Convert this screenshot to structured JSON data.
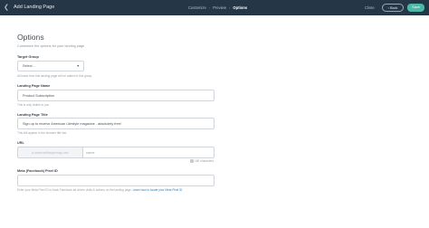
{
  "topbar": {
    "back_icon": "chevron-left-icon",
    "title": "Add Landing Page",
    "steps": [
      {
        "label": "Customize",
        "active": false
      },
      {
        "label": "Preview",
        "active": false
      },
      {
        "label": "Options",
        "active": true
      }
    ],
    "close_label": "Close",
    "back_label": "Back",
    "save_label": "Save"
  },
  "main": {
    "title": "Options",
    "subtitle": "Customize the options for your landing page.",
    "target_group": {
      "label": "Target Group",
      "value": "Select...",
      "hint": "All leads from this landing page will be added to this group."
    },
    "landing_page_name": {
      "label": "Landing Page Name",
      "value": "Product Subscription",
      "hint": "This is only visible to you."
    },
    "landing_page_title": {
      "label": "Landing Page Title",
      "value": "Sign up to receive American Lifestyle magazine - absolutely free!",
      "hint": "This will appear in the browser title bar."
    },
    "url": {
      "label": "URL",
      "prefix": "lp.americanlifestylemag.com/",
      "placeholder": "name",
      "count": "180 characters"
    },
    "meta_pixel": {
      "label": "Meta (Facebook) Pixel ID",
      "value": "",
      "hint": "Enter your Meta Pixel ID to track Facebook ad-driven visits & actions on the landing page.",
      "link": "Learn how to locate your Meta Pixel ID"
    }
  }
}
